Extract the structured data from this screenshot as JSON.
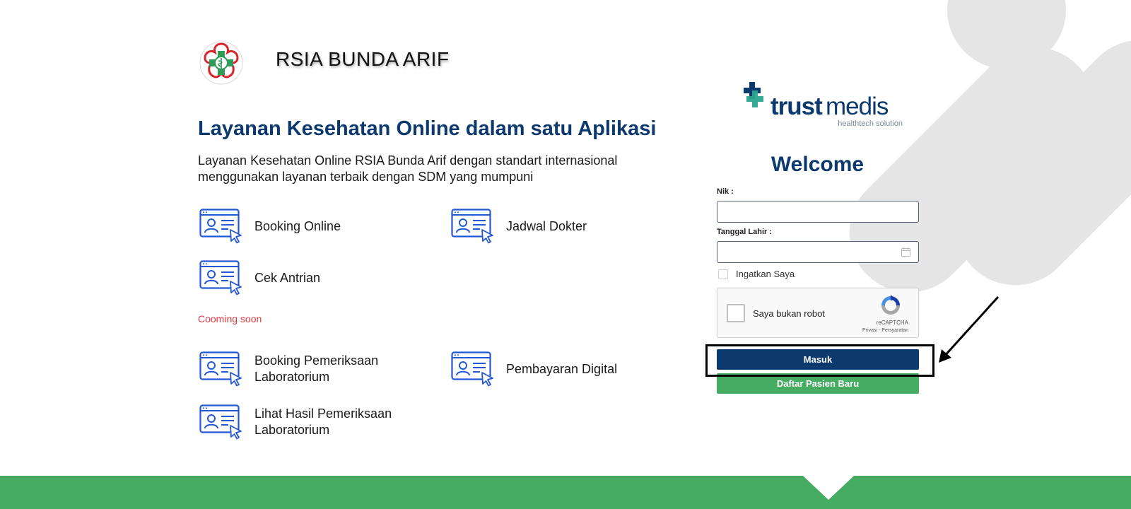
{
  "hospital": {
    "name": "RSIA BUNDA ARIF"
  },
  "hero": {
    "headline": "Layanan Kesehatan Online dalam satu Aplikasi",
    "description": "Layanan Kesehatan Online RSIA Bunda Arif dengan standart internasional menggunakan layanan terbaik dengan SDM yang mumpuni"
  },
  "services": [
    {
      "label": "Booking Online",
      "icon": "web-user-click-icon"
    },
    {
      "label": "Jadwal Dokter",
      "icon": "web-user-click-icon"
    },
    {
      "label": "Cek Antrian",
      "icon": "web-user-click-icon"
    }
  ],
  "coming_soon": {
    "label": "Cooming soon",
    "services": [
      {
        "label": "Booking Pemeriksaan Laboratorium",
        "icon": "web-user-click-icon"
      },
      {
        "label": "Pembayaran Digital",
        "icon": "web-user-click-icon"
      },
      {
        "label": "Lihat Hasil Pemeriksaan Laboratorium",
        "icon": "web-user-click-icon"
      }
    ]
  },
  "brand": {
    "name_bold": "trust",
    "name_light": "medis",
    "tagline": "healthtech solution"
  },
  "login": {
    "welcome": "Welcome",
    "nik_label": "Nik :",
    "nik_value": "",
    "dob_label": "Tanggal Lahir :",
    "dob_value": "",
    "remember_label": "Ingatkan Saya",
    "remember_checked": false,
    "captcha": {
      "label": "Saya bukan robot",
      "brand": "reCAPTCHA",
      "links": "Privasi - Persyaratan"
    },
    "login_button": "Masuk",
    "register_button": "Daftar Pasien Baru"
  },
  "colors": {
    "navy": "#0d3a6e",
    "green": "#45ac62",
    "teal": "#2aa58f",
    "red": "#e2393f",
    "icon_blue": "#2457d6"
  }
}
